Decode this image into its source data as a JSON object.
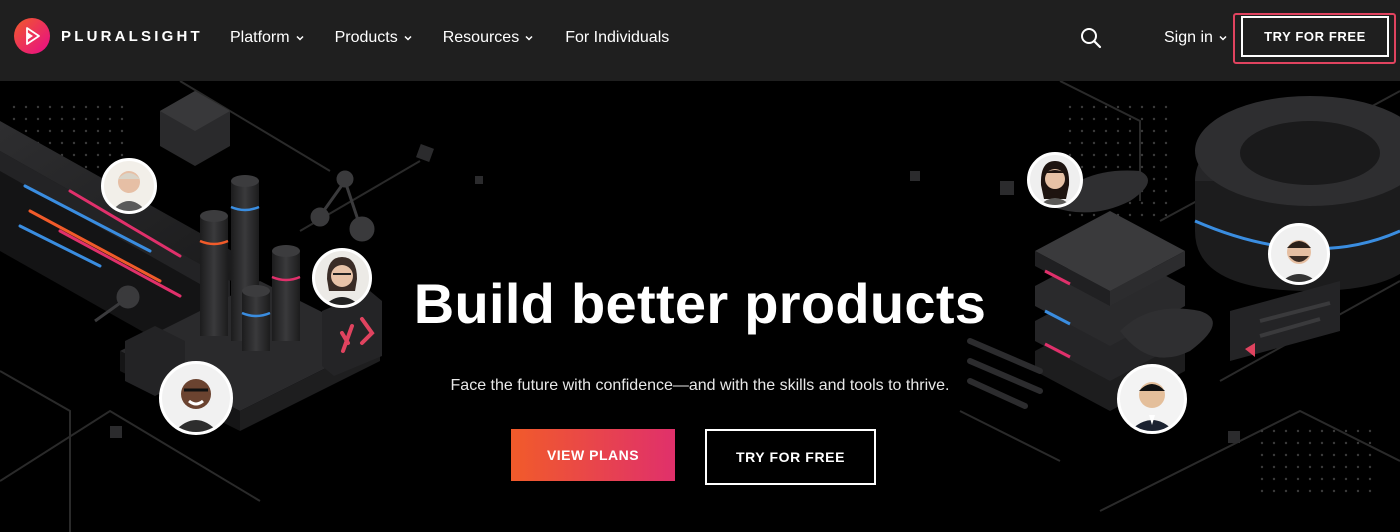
{
  "brand": {
    "name": "PLURALSIGHT",
    "gradient_start": "#f15b2a",
    "gradient_end": "#e80a89"
  },
  "nav": {
    "items": [
      {
        "label": "Platform",
        "has_dropdown": true
      },
      {
        "label": "Products",
        "has_dropdown": true
      },
      {
        "label": "Resources",
        "has_dropdown": true
      },
      {
        "label": "For Individuals",
        "has_dropdown": false
      }
    ],
    "search_icon": "search-icon",
    "signin_label": "Sign in",
    "try_label": "TRY FOR FREE"
  },
  "hero": {
    "headline": "Build better products",
    "subline": "Face the future with confidence—and with the skills and tools to thrive.",
    "primary_cta": "VIEW PLANS",
    "secondary_cta": "TRY FOR FREE"
  },
  "colors": {
    "nav_bg": "#1f1f1f",
    "hero_bg": "#000000",
    "accent_orange": "#f15b2a",
    "accent_pink": "#e0306b",
    "accent_blue": "#3a8de0",
    "focus_ring": "#e0435f"
  }
}
